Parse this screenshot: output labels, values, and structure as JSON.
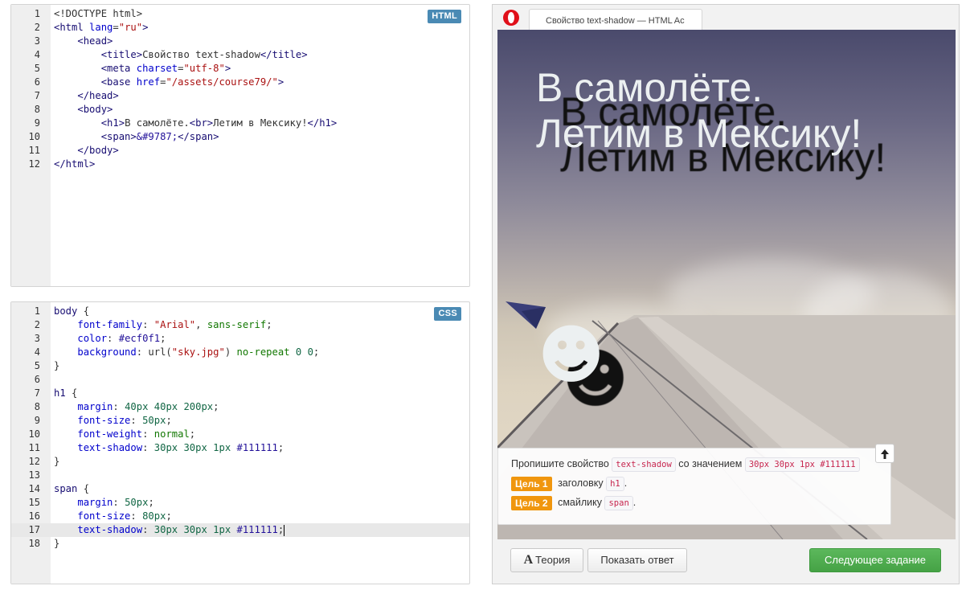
{
  "html_editor": {
    "badge": "HTML",
    "lines": [
      {
        "n": "1",
        "parts": [
          [
            "plain",
            "<!DOCTYPE html>"
          ]
        ]
      },
      {
        "n": "2",
        "parts": [
          [
            "tag",
            "<html "
          ],
          [
            "attr",
            "lang"
          ],
          [
            "plain",
            "="
          ],
          [
            "str",
            "\"ru\""
          ],
          [
            "tag",
            ">"
          ]
        ]
      },
      {
        "n": "3",
        "parts": [
          [
            "plain",
            "    "
          ],
          [
            "tag",
            "<head>"
          ]
        ]
      },
      {
        "n": "4",
        "parts": [
          [
            "plain",
            "        "
          ],
          [
            "tag",
            "<title>"
          ],
          [
            "plain",
            "Свойство text-shadow"
          ],
          [
            "tag",
            "</title>"
          ]
        ]
      },
      {
        "n": "5",
        "parts": [
          [
            "plain",
            "        "
          ],
          [
            "tag",
            "<meta "
          ],
          [
            "attr",
            "charset"
          ],
          [
            "plain",
            "="
          ],
          [
            "str",
            "\"utf-8\""
          ],
          [
            "tag",
            ">"
          ]
        ]
      },
      {
        "n": "6",
        "parts": [
          [
            "plain",
            "        "
          ],
          [
            "tag",
            "<base "
          ],
          [
            "attr",
            "href"
          ],
          [
            "plain",
            "="
          ],
          [
            "str",
            "\"/assets/course79/\""
          ],
          [
            "tag",
            ">"
          ]
        ]
      },
      {
        "n": "7",
        "parts": [
          [
            "plain",
            "    "
          ],
          [
            "tag",
            "</head>"
          ]
        ]
      },
      {
        "n": "8",
        "parts": [
          [
            "plain",
            "    "
          ],
          [
            "tag",
            "<body>"
          ]
        ]
      },
      {
        "n": "9",
        "parts": [
          [
            "plain",
            "        "
          ],
          [
            "tag",
            "<h1>"
          ],
          [
            "plain",
            "В самолёте."
          ],
          [
            "tag",
            "<br>"
          ],
          [
            "plain",
            "Летим в Мексику!"
          ],
          [
            "tag",
            "</h1>"
          ]
        ]
      },
      {
        "n": "10",
        "parts": [
          [
            "plain",
            "        "
          ],
          [
            "tag",
            "<span>"
          ],
          [
            "ent",
            "&#9787;"
          ],
          [
            "tag",
            "</span>"
          ]
        ]
      },
      {
        "n": "11",
        "parts": [
          [
            "plain",
            "    "
          ],
          [
            "tag",
            "</body>"
          ]
        ]
      },
      {
        "n": "12",
        "parts": [
          [
            "tag",
            "</html>"
          ]
        ]
      }
    ]
  },
  "css_editor": {
    "badge": "CSS",
    "lines": [
      {
        "n": "1",
        "parts": [
          [
            "tag",
            "body"
          ],
          [
            "plain",
            " {"
          ]
        ]
      },
      {
        "n": "2",
        "parts": [
          [
            "plain",
            "    "
          ],
          [
            "prop",
            "font-family"
          ],
          [
            "plain",
            ": "
          ],
          [
            "str",
            "\"Arial\""
          ],
          [
            "plain",
            ", "
          ],
          [
            "kw",
            "sans-serif"
          ],
          [
            "plain",
            ";"
          ]
        ]
      },
      {
        "n": "3",
        "parts": [
          [
            "plain",
            "    "
          ],
          [
            "prop",
            "color"
          ],
          [
            "plain",
            ": "
          ],
          [
            "hex",
            "#ecf0f1"
          ],
          [
            "plain",
            ";"
          ]
        ]
      },
      {
        "n": "4",
        "parts": [
          [
            "plain",
            "    "
          ],
          [
            "prop",
            "background"
          ],
          [
            "plain",
            ": url("
          ],
          [
            "str",
            "\"sky.jpg\""
          ],
          [
            "plain",
            ") "
          ],
          [
            "kw",
            "no-repeat"
          ],
          [
            "plain",
            " "
          ],
          [
            "num",
            "0"
          ],
          [
            "plain",
            " "
          ],
          [
            "num",
            "0"
          ],
          [
            "plain",
            ";"
          ]
        ]
      },
      {
        "n": "5",
        "parts": [
          [
            "plain",
            "}"
          ]
        ]
      },
      {
        "n": "6",
        "parts": [
          [
            "plain",
            ""
          ]
        ]
      },
      {
        "n": "7",
        "parts": [
          [
            "tag",
            "h1"
          ],
          [
            "plain",
            " {"
          ]
        ]
      },
      {
        "n": "8",
        "parts": [
          [
            "plain",
            "    "
          ],
          [
            "prop",
            "margin"
          ],
          [
            "plain",
            ": "
          ],
          [
            "num",
            "40px 40px 200px"
          ],
          [
            "plain",
            ";"
          ]
        ]
      },
      {
        "n": "9",
        "parts": [
          [
            "plain",
            "    "
          ],
          [
            "prop",
            "font-size"
          ],
          [
            "plain",
            ": "
          ],
          [
            "num",
            "50px"
          ],
          [
            "plain",
            ";"
          ]
        ]
      },
      {
        "n": "10",
        "parts": [
          [
            "plain",
            "    "
          ],
          [
            "prop",
            "font-weight"
          ],
          [
            "plain",
            ": "
          ],
          [
            "kw",
            "normal"
          ],
          [
            "plain",
            ";"
          ]
        ]
      },
      {
        "n": "11",
        "parts": [
          [
            "plain",
            "    "
          ],
          [
            "prop",
            "text-shadow"
          ],
          [
            "plain",
            ": "
          ],
          [
            "num",
            "30px 30px 1px"
          ],
          [
            "plain",
            " "
          ],
          [
            "hex",
            "#111111"
          ],
          [
            "plain",
            ";"
          ]
        ]
      },
      {
        "n": "12",
        "parts": [
          [
            "plain",
            "}"
          ]
        ]
      },
      {
        "n": "13",
        "parts": [
          [
            "plain",
            ""
          ]
        ]
      },
      {
        "n": "14",
        "parts": [
          [
            "tag",
            "span"
          ],
          [
            "plain",
            " {"
          ]
        ]
      },
      {
        "n": "15",
        "parts": [
          [
            "plain",
            "    "
          ],
          [
            "prop",
            "margin"
          ],
          [
            "plain",
            ": "
          ],
          [
            "num",
            "50px"
          ],
          [
            "plain",
            ";"
          ]
        ]
      },
      {
        "n": "16",
        "parts": [
          [
            "plain",
            "    "
          ],
          [
            "prop",
            "font-size"
          ],
          [
            "plain",
            ": "
          ],
          [
            "num",
            "80px"
          ],
          [
            "plain",
            ";"
          ]
        ]
      },
      {
        "n": "17",
        "active": true,
        "parts": [
          [
            "plain",
            "    "
          ],
          [
            "prop",
            "text-shadow"
          ],
          [
            "plain",
            ": "
          ],
          [
            "num",
            "30px 30px 1px"
          ],
          [
            "plain",
            " "
          ],
          [
            "hex",
            "#111111"
          ],
          [
            "plain",
            ";"
          ]
        ]
      },
      {
        "n": "18",
        "parts": [
          [
            "plain",
            "}"
          ]
        ]
      }
    ]
  },
  "browser": {
    "tab_title": "Свойство text-shadow — HTML Ac",
    "page": {
      "h1_line1": "В самолёте.",
      "h1_line2": "Летим в Мексику!",
      "smiley": "☻"
    }
  },
  "task": {
    "intro": "Пропишите свойство",
    "property": "text-shadow",
    "with_value": "со значением",
    "value": "30px 30px 1px #111111",
    "goals": [
      {
        "badge": "Цель 1",
        "text": "заголовку",
        "chip": "h1",
        "tail": "."
      },
      {
        "badge": "Цель 2",
        "text": "смайлику",
        "chip": "span",
        "tail": "."
      }
    ],
    "collapse_icon": "arrow-up-icon"
  },
  "buttons": {
    "theory_icon": "A",
    "theory": "Теория",
    "show_answer": "Показать ответ",
    "next": "Следующее задание"
  },
  "colors": {
    "accent_green": "#4cae4c",
    "goal_orange": "#f0960e",
    "badge_blue": "#4a8ab4"
  }
}
